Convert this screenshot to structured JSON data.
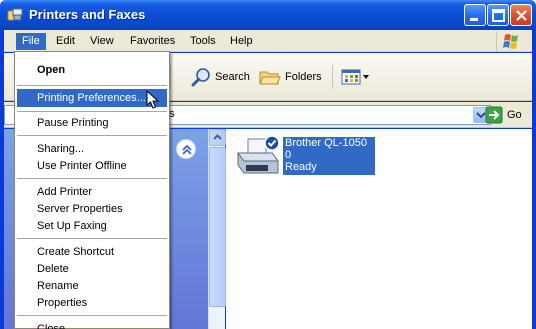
{
  "window": {
    "title": "Printers and Faxes",
    "title_icon": "printer-folder-icon"
  },
  "menubar": {
    "items": [
      "File",
      "Edit",
      "View",
      "Favorites",
      "Tools",
      "Help"
    ],
    "active": "File"
  },
  "toolbar": {
    "search_label": "Search",
    "folders_label": "Folders"
  },
  "address": {
    "value_visible": "s",
    "go_label": "Go"
  },
  "printer": {
    "name": "Brother QL-1050",
    "documents": "0",
    "status": "Ready"
  },
  "file_menu": {
    "items": [
      {
        "label": "Open",
        "bold": true
      },
      {
        "label": "Printing Preferences...",
        "highlighted": true
      },
      {
        "label": "Pause Printing"
      },
      {
        "label": "Sharing..."
      },
      {
        "label": "Use Printer Offline"
      },
      {
        "label": "Add Printer"
      },
      {
        "label": "Server Properties"
      },
      {
        "label": "Set Up Faxing"
      },
      {
        "label": "Create Shortcut"
      },
      {
        "label": "Delete"
      },
      {
        "label": "Rename"
      },
      {
        "label": "Properties"
      },
      {
        "label": "Close"
      }
    ]
  },
  "colors": {
    "titlebar": "#0a4fd8",
    "selection": "#316ac5",
    "menu_bg": "#ece9d8",
    "task_pane": "#7ba2e7"
  }
}
